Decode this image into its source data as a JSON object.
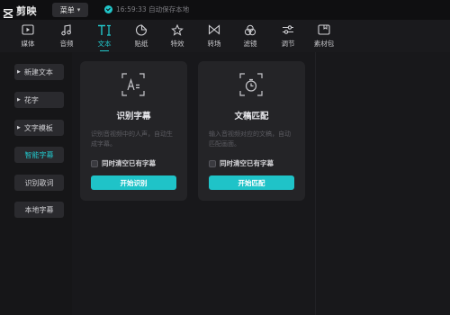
{
  "app": {
    "name": "剪映"
  },
  "titlebar": {
    "menu_label": "菜单",
    "save_status": "16:59:33 自动保存本地"
  },
  "toolbar": {
    "tools": [
      {
        "label": "媒体",
        "icon": "media-icon"
      },
      {
        "label": "音频",
        "icon": "audio-icon"
      },
      {
        "label": "文本",
        "icon": "text-icon",
        "active": true
      },
      {
        "label": "贴纸",
        "icon": "sticker-icon"
      },
      {
        "label": "特效",
        "icon": "effects-icon"
      },
      {
        "label": "转场",
        "icon": "transition-icon"
      },
      {
        "label": "滤镜",
        "icon": "filter-icon"
      },
      {
        "label": "调节",
        "icon": "adjust-icon"
      },
      {
        "label": "素材包",
        "icon": "material-pack-icon"
      }
    ]
  },
  "sidebar": {
    "items": [
      {
        "label": "新建文本",
        "caret": true
      },
      {
        "label": "花字",
        "caret": true
      },
      {
        "label": "文字模板",
        "caret": true
      },
      {
        "label": "智能字幕",
        "active": true
      },
      {
        "label": "识别歌词"
      },
      {
        "label": "本地字幕"
      }
    ]
  },
  "cards": [
    {
      "title": "识别字幕",
      "description": "识别音视频中的人声，自动生成字幕。",
      "checkbox_label": "同时清空已有字幕",
      "checked": false,
      "button_label": "开始识别"
    },
    {
      "title": "文稿匹配",
      "description": "输入音视频对应的文稿，自动匹配画面。",
      "checkbox_label": "同时清空已有字幕",
      "checked": false,
      "button_label": "开始匹配"
    }
  ],
  "colors": {
    "accent": "#22c7cb",
    "button": "#1fc3c8",
    "background": "#131316",
    "card": "#242427"
  }
}
